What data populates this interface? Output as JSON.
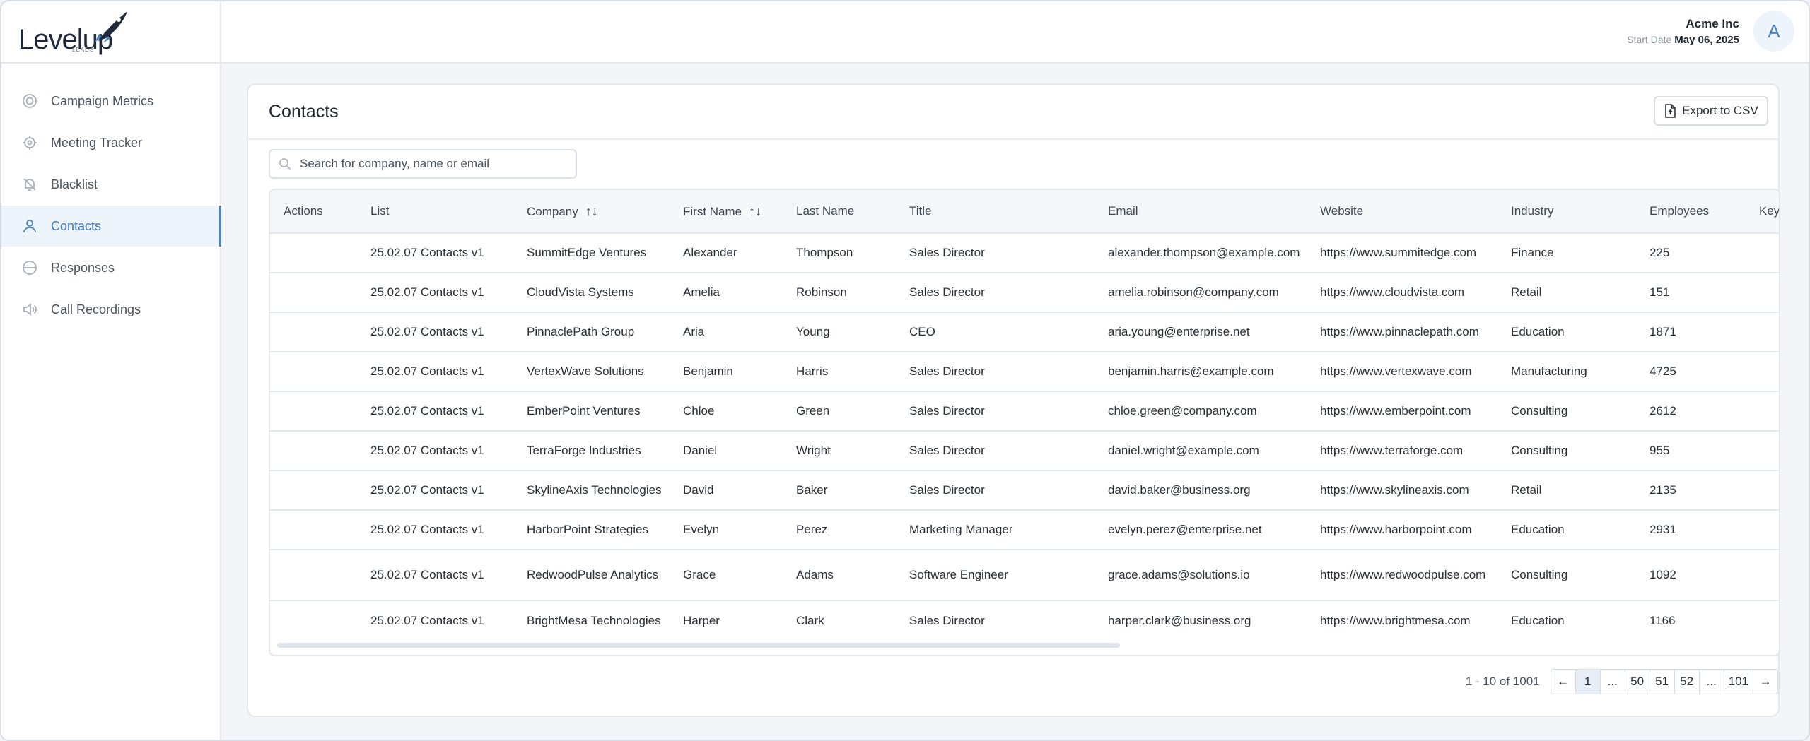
{
  "brand": {
    "logo_text": "Levelup",
    "logo_sub": "LEADS"
  },
  "sidebar": {
    "items": [
      {
        "label": "Campaign Metrics",
        "icon": "target-icon",
        "active": false
      },
      {
        "label": "Meeting Tracker",
        "icon": "crosshair-icon",
        "active": false
      },
      {
        "label": "Blacklist",
        "icon": "bell-off-icon",
        "active": false
      },
      {
        "label": "Contacts",
        "icon": "user-icon",
        "active": true
      },
      {
        "label": "Responses",
        "icon": "minus-circle-icon",
        "active": false
      },
      {
        "label": "Call Recordings",
        "icon": "speaker-icon",
        "active": false
      }
    ]
  },
  "header": {
    "company": "Acme Inc",
    "start_label": "Start Date",
    "start_date": "May 06, 2025",
    "avatar_letter": "A"
  },
  "colors": {
    "accent": "#4b86c5",
    "active_bg": "#eef4fb",
    "border": "#e3e8ee"
  },
  "contacts": {
    "title": "Contacts",
    "export_label": "Export to CSV",
    "search_placeholder": "Search for company, name or email",
    "columns": [
      "Actions",
      "List",
      "Company",
      "First Name",
      "Last Name",
      "Title",
      "Email",
      "Website",
      "Industry",
      "Employees",
      "Key"
    ],
    "rows": [
      [
        "",
        "25.02.07 Contacts v1",
        "SummitEdge Ventures",
        "Alexander",
        "Thompson",
        "Sales Director",
        "alexander.thompson@example.com",
        "https://www.summitedge.com",
        "Finance",
        "225",
        ""
      ],
      [
        "",
        "25.02.07 Contacts v1",
        "CloudVista Systems",
        "Amelia",
        "Robinson",
        "Sales Director",
        "amelia.robinson@company.com",
        "https://www.cloudvista.com",
        "Retail",
        "151",
        ""
      ],
      [
        "",
        "25.02.07 Contacts v1",
        "PinnaclePath Group",
        "Aria",
        "Young",
        "CEO",
        "aria.young@enterprise.net",
        "https://www.pinnaclepath.com",
        "Education",
        "1871",
        ""
      ],
      [
        "",
        "25.02.07 Contacts v1",
        "VertexWave Solutions",
        "Benjamin",
        "Harris",
        "Sales Director",
        "benjamin.harris@example.com",
        "https://www.vertexwave.com",
        "Manufacturing",
        "4725",
        ""
      ],
      [
        "",
        "25.02.07 Contacts v1",
        "EmberPoint Ventures",
        "Chloe",
        "Green",
        "Sales Director",
        "chloe.green@company.com",
        "https://www.emberpoint.com",
        "Consulting",
        "2612",
        ""
      ],
      [
        "",
        "25.02.07 Contacts v1",
        "TerraForge Industries",
        "Daniel",
        "Wright",
        "Sales Director",
        "daniel.wright@example.com",
        "https://www.terraforge.com",
        "Consulting",
        "955",
        ""
      ],
      [
        "",
        "25.02.07 Contacts v1",
        "SkylineAxis Technologies",
        "David",
        "Baker",
        "Sales Director",
        "david.baker@business.org",
        "https://www.skylineaxis.com",
        "Retail",
        "2135",
        ""
      ],
      [
        "",
        "25.02.07 Contacts v1",
        "HarborPoint Strategies",
        "Evelyn",
        "Perez",
        "Marketing Manager",
        "evelyn.perez@enterprise.net",
        "https://www.harborpoint.com",
        "Education",
        "2931",
        ""
      ],
      [
        "",
        "25.02.07 Contacts v1",
        "RedwoodPulse Analytics",
        "Grace",
        "Adams",
        "Software Engineer",
        "grace.adams@solutions.io",
        "https://www.redwoodpulse.com",
        "Consulting",
        "1092",
        ""
      ],
      [
        "",
        "25.02.07 Contacts v1",
        "BrightMesa Technologies",
        "Harper",
        "Clark",
        "Sales Director",
        "harper.clark@business.org",
        "https://www.brightmesa.com",
        "Education",
        "1166",
        ""
      ]
    ]
  },
  "pagination": {
    "summary": "1 - 10 of 1001",
    "prev": "←",
    "next": "→",
    "pages": [
      "1",
      "...",
      "50",
      "51",
      "52",
      "...",
      "101"
    ],
    "current": "1"
  }
}
